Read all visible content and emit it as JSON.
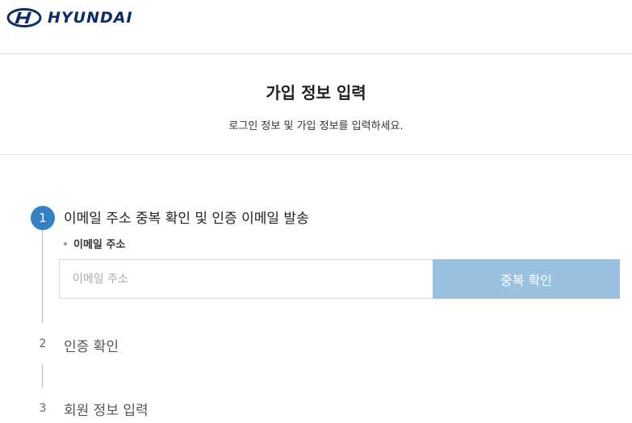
{
  "header": {
    "brand": "HYUNDAI",
    "logo_icon": "hyundai-logo-icon"
  },
  "intro": {
    "title": "가입 정보 입력",
    "subtitle": "로그인 정보 및 가입 정보를 입력하세요."
  },
  "steps": [
    {
      "number": "1",
      "title": "이메일 주소 중복 확인 및 인증 이메일 발송",
      "active": true
    },
    {
      "number": "2",
      "title": "인증 확인",
      "active": false
    },
    {
      "number": "3",
      "title": "회원 정보 입력",
      "active": false
    }
  ],
  "email_form": {
    "label": "이메일 주소",
    "placeholder": "이메일 주소",
    "value": "",
    "button_label": "중복 확인"
  },
  "colors": {
    "brand": "#0b2d67",
    "accent": "#3380c4",
    "button_disabled": "#9ac2e0"
  }
}
